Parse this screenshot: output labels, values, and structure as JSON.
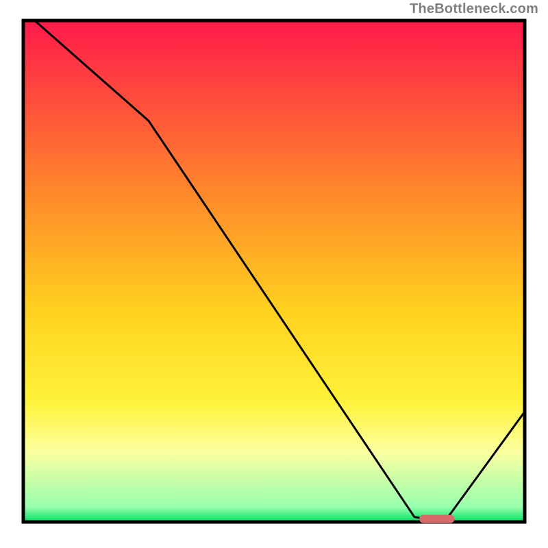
{
  "watermark": "TheBottleneck.com",
  "chart_data": {
    "type": "line",
    "title": "",
    "xlabel": "",
    "ylabel": "",
    "xlim": [
      0,
      100
    ],
    "ylim": [
      0,
      100
    ],
    "curve": [
      {
        "x": 0,
        "y": 102
      },
      {
        "x": 25,
        "y": 80
      },
      {
        "x": 78,
        "y": 1
      },
      {
        "x": 84,
        "y": 0
      },
      {
        "x": 100,
        "y": 22
      }
    ],
    "marker": {
      "x_start": 79,
      "x_end": 86,
      "y": 0.6
    },
    "gradient_stops": [
      {
        "pct": 0,
        "color": "#ff1a4b"
      },
      {
        "pct": 35,
        "color": "#ff8a2a"
      },
      {
        "pct": 58,
        "color": "#ffd21f"
      },
      {
        "pct": 76,
        "color": "#fff23a"
      },
      {
        "pct": 86,
        "color": "#fcffa0"
      },
      {
        "pct": 97,
        "color": "#97ffae"
      },
      {
        "pct": 100,
        "color": "#00e060"
      }
    ],
    "border_color": "#000000",
    "curve_color": "#000000",
    "marker_color": "#d86a6a"
  }
}
